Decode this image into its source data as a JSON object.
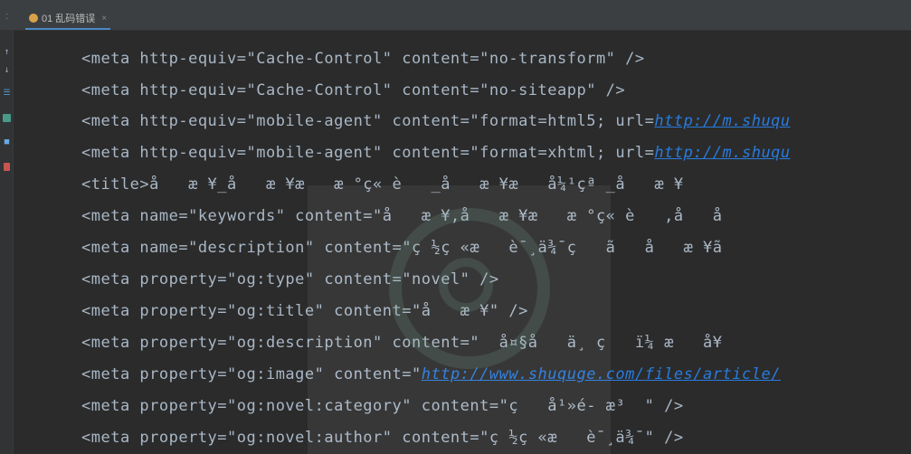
{
  "tab": {
    "label": "01 乱码错误",
    "close": "×",
    "sep": ":"
  },
  "lines": [
    "<meta http-equiv=\"Cache-Control\" content=\"no-transform\" />",
    "<meta http-equiv=\"Cache-Control\" content=\"no-siteapp\" />",
    "<meta http-equiv=\"mobile-agent\" content=\"format=html5; url=",
    "<meta http-equiv=\"mobile-agent\" content=\"format=xhtml; url=",
    "<title>å   æ ¥_å   æ ¥æ   æ °ç« è   _å   æ ¥æ   å¼¹çª _å   æ ¥",
    "<meta name=\"keywords\" content=\"å   æ ¥,å   æ ¥æ   æ °ç« è   ,å   å",
    "<meta name=\"description\" content=\"ç ½ç «æ   è¯¸ä¾¯ç   ã   å   æ ¥ã",
    "<meta property=\"og:type\" content=\"novel\" />",
    "<meta property=\"og:title\" content=\"å   æ ¥\" />",
    "<meta property=\"og:description\" content=\"  å¤§å   ä¸ ç   ï¼ æ   å¥",
    "<meta property=\"og:image\" content=\"",
    "<meta property=\"og:novel:category\" content=\"ç   å¹»é- æ³  \" />",
    "<meta property=\"og:novel:author\" content=\"ç ½ç «æ   è¯¸ä¾¯\" />"
  ],
  "links": {
    "line3": "http://m.shuqu",
    "line4": "http://m.shuqu",
    "line11": "http://www.shuquge.com/files/article/"
  },
  "icons": [
    "arrow-up-icon",
    "arrow-down-icon",
    "soft-wrap-icon",
    "stop-icon",
    "print-icon",
    "trash-icon"
  ]
}
